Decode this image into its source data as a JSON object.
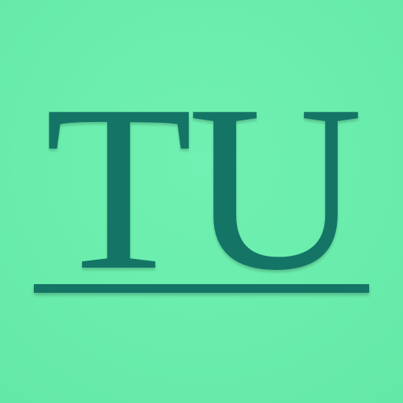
{
  "icon": {
    "monogram": "TU",
    "background_color": "#6AEDAC",
    "foreground_color": "#147566"
  }
}
